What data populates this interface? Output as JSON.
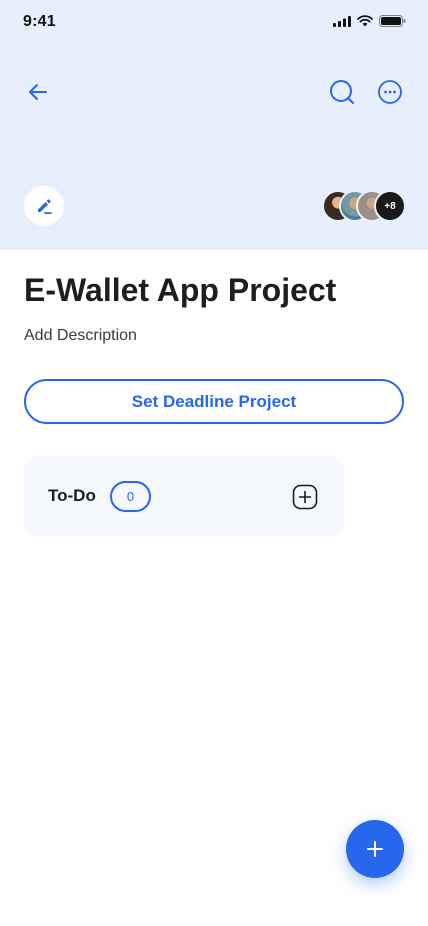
{
  "status_bar": {
    "time": "9:41"
  },
  "header": {
    "back_icon": "arrow-left-icon",
    "search_icon": "search-icon",
    "more_icon": "more-horizontal-icon",
    "edit_icon": "pencil-icon",
    "members_more_label": "+8"
  },
  "project": {
    "title": "E-Wallet App Project",
    "description_placeholder": "Add Description",
    "deadline_button_label": "Set Deadline Project"
  },
  "columns": [
    {
      "label": "To-Do",
      "count": "0"
    }
  ],
  "fab": {
    "icon": "plus-icon"
  },
  "colors": {
    "accent": "#2767ee",
    "header_bg": "#e8effc",
    "card_bg": "#f4f7fb"
  }
}
